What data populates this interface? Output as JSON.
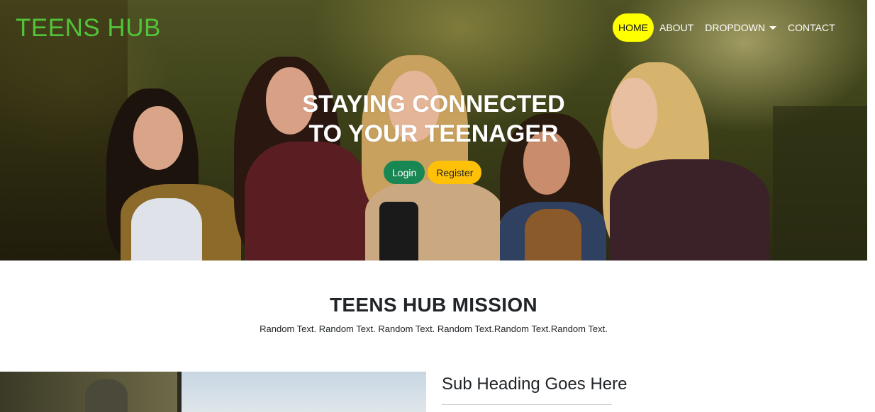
{
  "nav": {
    "brand": "TEENS HUB",
    "links": [
      {
        "label": "HOME",
        "active": true
      },
      {
        "label": "ABOUT",
        "active": false
      },
      {
        "label": "DROPDOWN",
        "active": false,
        "has_caret": true
      },
      {
        "label": "CONTACT",
        "active": false
      }
    ]
  },
  "hero": {
    "title_line1": "STAYING CONNECTED",
    "title_line2": "TO YOUR TEENAGER",
    "login_label": "Login",
    "register_label": "Register"
  },
  "mission": {
    "title": "TEENS HUB MISSION",
    "text": "Random Text. Random Text. Random Text. Random Text.Random Text.Random Text."
  },
  "section": {
    "sub_heading": "Sub Heading Goes Here"
  },
  "colors": {
    "brand": "#52c43a",
    "active_nav_bg": "#ffff00",
    "login_bg": "#198754",
    "register_bg": "#ffc107"
  },
  "icons": {
    "dropdown_caret": "chevron-down-icon"
  }
}
